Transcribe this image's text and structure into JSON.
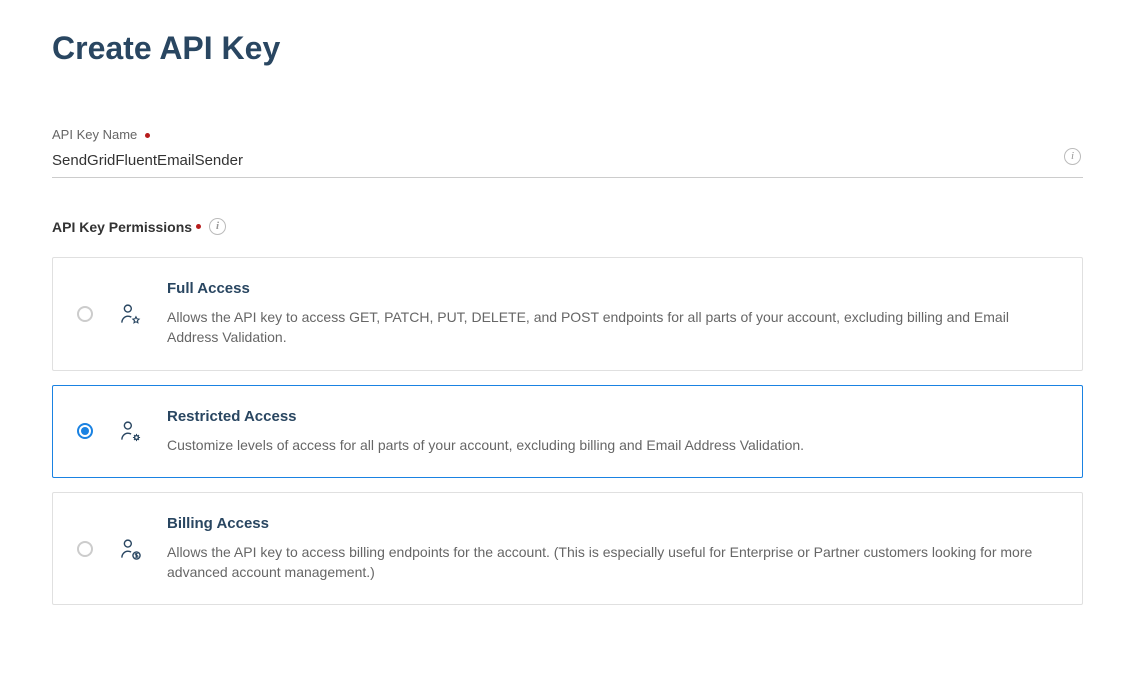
{
  "page": {
    "title": "Create API Key"
  },
  "fields": {
    "name_label": "API Key Name",
    "name_value": "SendGridFluentEmailSender",
    "permissions_label": "API Key Permissions"
  },
  "options": {
    "selected": "restricted",
    "full": {
      "title": "Full Access",
      "description": "Allows the API key to access GET, PATCH, PUT, DELETE, and POST endpoints for all parts of your account, excluding billing and Email Address Validation."
    },
    "restricted": {
      "title": "Restricted Access",
      "description": "Customize levels of access for all parts of your account, excluding billing and Email Address Validation."
    },
    "billing": {
      "title": "Billing Access",
      "description": "Allows the API key to access billing endpoints for the account. (This is especially useful for Enterprise or Partner customers looking for more advanced account management.)"
    }
  }
}
